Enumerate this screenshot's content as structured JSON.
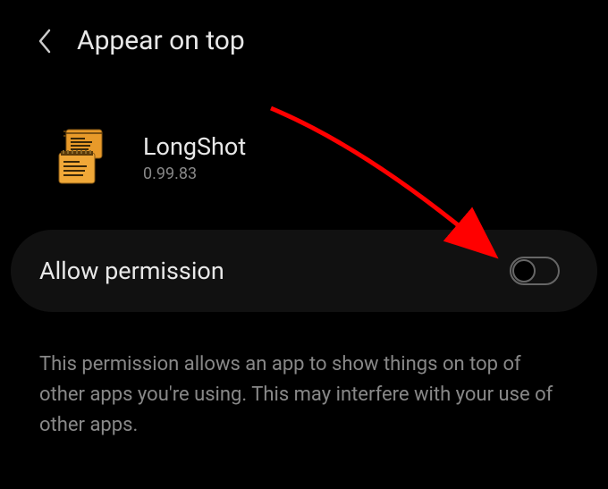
{
  "header": {
    "title": "Appear on top"
  },
  "app": {
    "name": "LongShot",
    "version": "0.99.83"
  },
  "permission": {
    "label": "Allow permission",
    "enabled": false
  },
  "description": "This permission allows an app to show things on top of other apps you're using. This may interfere with your use of other apps."
}
